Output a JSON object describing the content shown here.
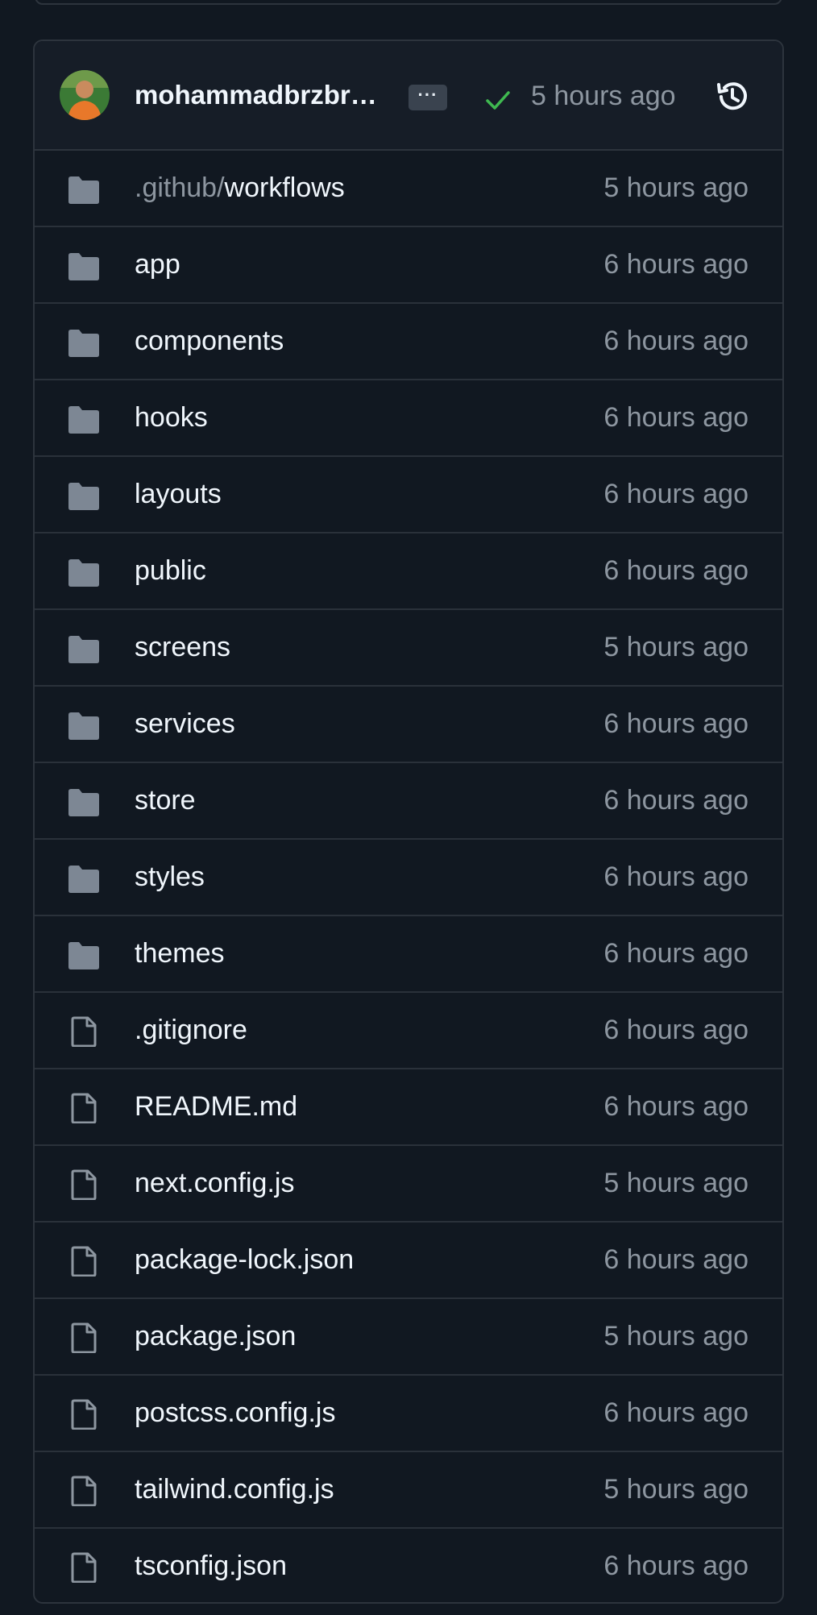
{
  "commit": {
    "author": "mohammadbrzbr…",
    "more_label": "···",
    "status": "success",
    "time": "5 hours ago"
  },
  "colors": {
    "background": "#111821",
    "border": "#2d343d",
    "folder_icon": "#7d8794",
    "check": "#3fb950",
    "muted_text": "#8d96a0",
    "text": "#f0f6fc"
  },
  "entries": [
    {
      "type": "folder",
      "prefix": ".github/",
      "name": "workflows",
      "time": "5 hours ago"
    },
    {
      "type": "folder",
      "prefix": "",
      "name": "app",
      "time": "6 hours ago"
    },
    {
      "type": "folder",
      "prefix": "",
      "name": "components",
      "time": "6 hours ago"
    },
    {
      "type": "folder",
      "prefix": "",
      "name": "hooks",
      "time": "6 hours ago"
    },
    {
      "type": "folder",
      "prefix": "",
      "name": "layouts",
      "time": "6 hours ago"
    },
    {
      "type": "folder",
      "prefix": "",
      "name": "public",
      "time": "6 hours ago"
    },
    {
      "type": "folder",
      "prefix": "",
      "name": "screens",
      "time": "5 hours ago"
    },
    {
      "type": "folder",
      "prefix": "",
      "name": "services",
      "time": "6 hours ago"
    },
    {
      "type": "folder",
      "prefix": "",
      "name": "store",
      "time": "6 hours ago"
    },
    {
      "type": "folder",
      "prefix": "",
      "name": "styles",
      "time": "6 hours ago"
    },
    {
      "type": "folder",
      "prefix": "",
      "name": "themes",
      "time": "6 hours ago"
    },
    {
      "type": "file",
      "prefix": "",
      "name": ".gitignore",
      "time": "6 hours ago"
    },
    {
      "type": "file",
      "prefix": "",
      "name": "README.md",
      "time": "6 hours ago"
    },
    {
      "type": "file",
      "prefix": "",
      "name": "next.config.js",
      "time": "5 hours ago"
    },
    {
      "type": "file",
      "prefix": "",
      "name": "package-lock.json",
      "time": "6 hours ago"
    },
    {
      "type": "file",
      "prefix": "",
      "name": "package.json",
      "time": "5 hours ago"
    },
    {
      "type": "file",
      "prefix": "",
      "name": "postcss.config.js",
      "time": "6 hours ago"
    },
    {
      "type": "file",
      "prefix": "",
      "name": "tailwind.config.js",
      "time": "5 hours ago"
    },
    {
      "type": "file",
      "prefix": "",
      "name": "tsconfig.json",
      "time": "6 hours ago"
    }
  ]
}
